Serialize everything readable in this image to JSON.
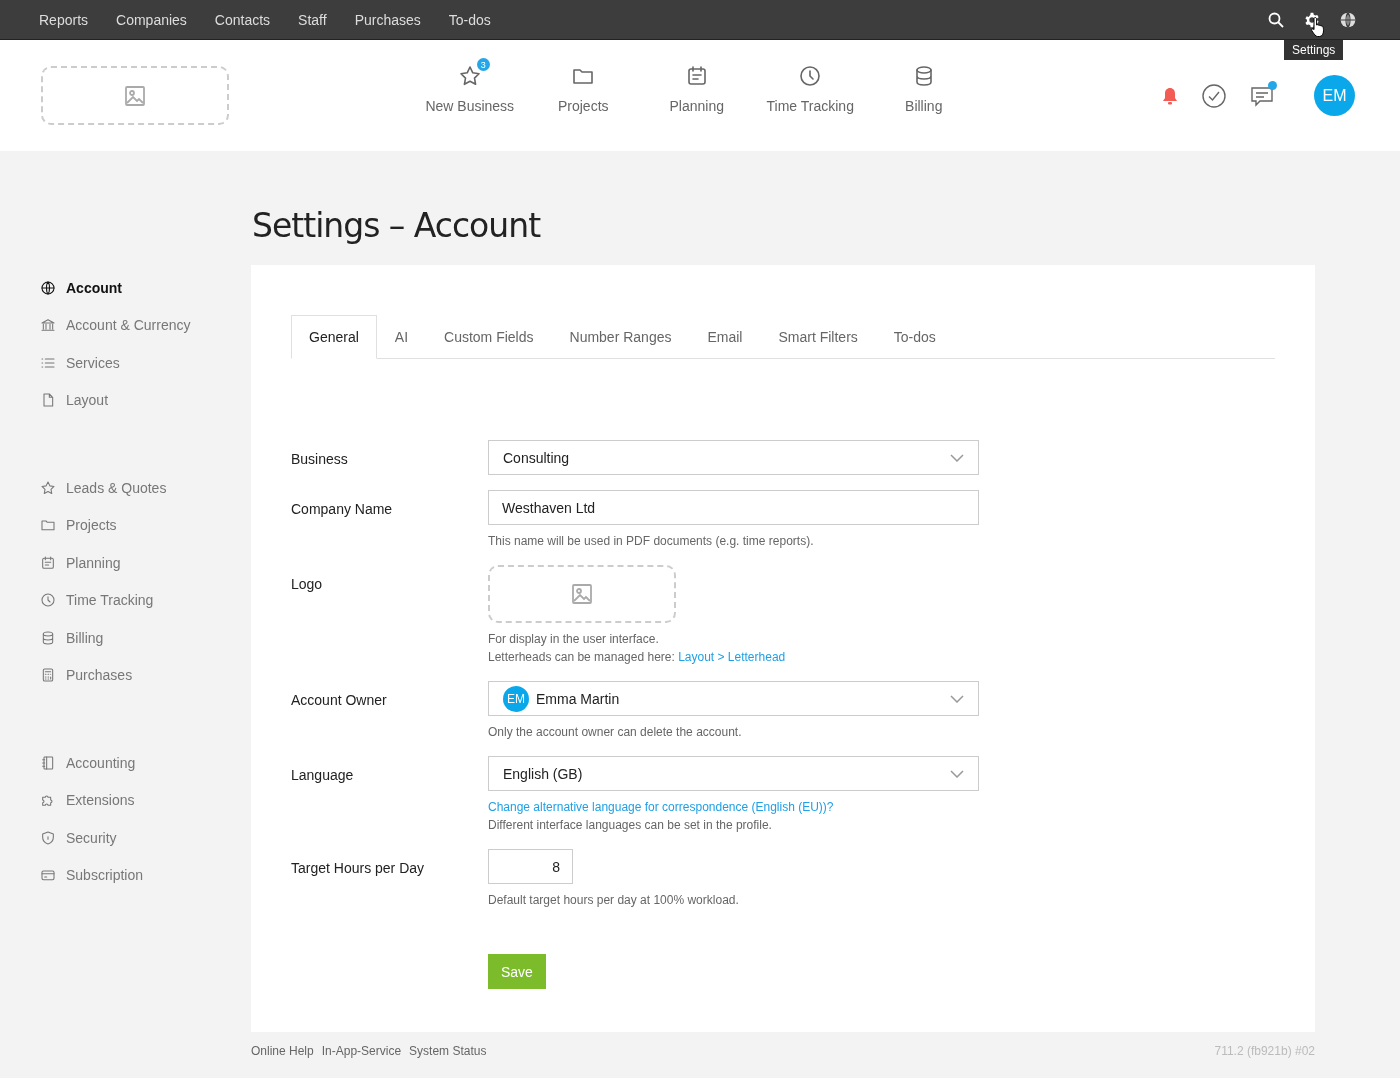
{
  "top_bar": {
    "menu": [
      "Reports",
      "Companies",
      "Contacts",
      "Staff",
      "Purchases",
      "To-dos"
    ],
    "tooltip": "Settings"
  },
  "header": {
    "nav": [
      {
        "label": "New Business",
        "badge": "3"
      },
      {
        "label": "Projects"
      },
      {
        "label": "Planning"
      },
      {
        "label": "Time Tracking"
      },
      {
        "label": "Billing"
      }
    ],
    "chat_unread": true,
    "avatar": "EM"
  },
  "page_title": "Settings – Account",
  "sidebar": {
    "groups": [
      {
        "items": [
          {
            "label": "Account",
            "selected": true
          },
          {
            "label": "Account & Currency",
            "selected": false
          },
          {
            "label": "Services",
            "selected": false
          },
          {
            "label": "Layout",
            "selected": false
          }
        ]
      },
      {
        "items": [
          {
            "label": "Leads & Quotes",
            "selected": false
          },
          {
            "label": "Projects",
            "selected": false
          },
          {
            "label": "Planning",
            "selected": false
          },
          {
            "label": "Time Tracking",
            "selected": false
          },
          {
            "label": "Billing",
            "selected": false
          },
          {
            "label": "Purchases",
            "selected": false
          }
        ]
      },
      {
        "items": [
          {
            "label": "Accounting",
            "selected": false
          },
          {
            "label": "Extensions",
            "selected": false
          },
          {
            "label": "Security",
            "selected": false
          },
          {
            "label": "Subscription",
            "selected": false
          }
        ]
      }
    ]
  },
  "tabs": [
    {
      "label": "General",
      "selected": true
    },
    {
      "label": "AI",
      "selected": false
    },
    {
      "label": "Custom Fields",
      "selected": false
    },
    {
      "label": "Number Ranges",
      "selected": false
    },
    {
      "label": "Email",
      "selected": false
    },
    {
      "label": "Smart Filters",
      "selected": false
    },
    {
      "label": "To-dos",
      "selected": false
    }
  ],
  "form": [
    {
      "label": "Business",
      "kind": "select",
      "value": "Consulting"
    },
    {
      "label": "Company Name",
      "kind": "text",
      "value": "Westhaven Ltd",
      "hints": [
        {
          "text": "This name will be used in PDF documents (e.g. time reports)."
        }
      ]
    },
    {
      "label": "Logo",
      "kind": "logo",
      "hints": [
        {
          "text": "For display in the user interface."
        },
        {
          "text": "Letterheads can be managed here:",
          "link": "Layout > Letterhead"
        }
      ]
    },
    {
      "label": "Account Owner",
      "kind": "user",
      "avatar": "EM",
      "value": "Emma Martin",
      "hints": [
        {
          "text": "Only the account owner can delete the account."
        }
      ]
    },
    {
      "label": "Language",
      "kind": "select",
      "value": "English (GB)",
      "hints": [
        {
          "link": "Change alternative language for correspondence (English (EU))?"
        },
        {
          "text": "Different interface languages can be set in the profile."
        }
      ]
    },
    {
      "label": "Target Hours per Day",
      "kind": "number",
      "value": "8",
      "hints": [
        {
          "text": "Default target hours per day at 100% workload."
        }
      ]
    }
  ],
  "save_button": "Save",
  "footer": {
    "links": [
      "Online Help",
      "In-App-Service",
      "System Status"
    ],
    "version": "711.2 (fb921b) #02"
  }
}
